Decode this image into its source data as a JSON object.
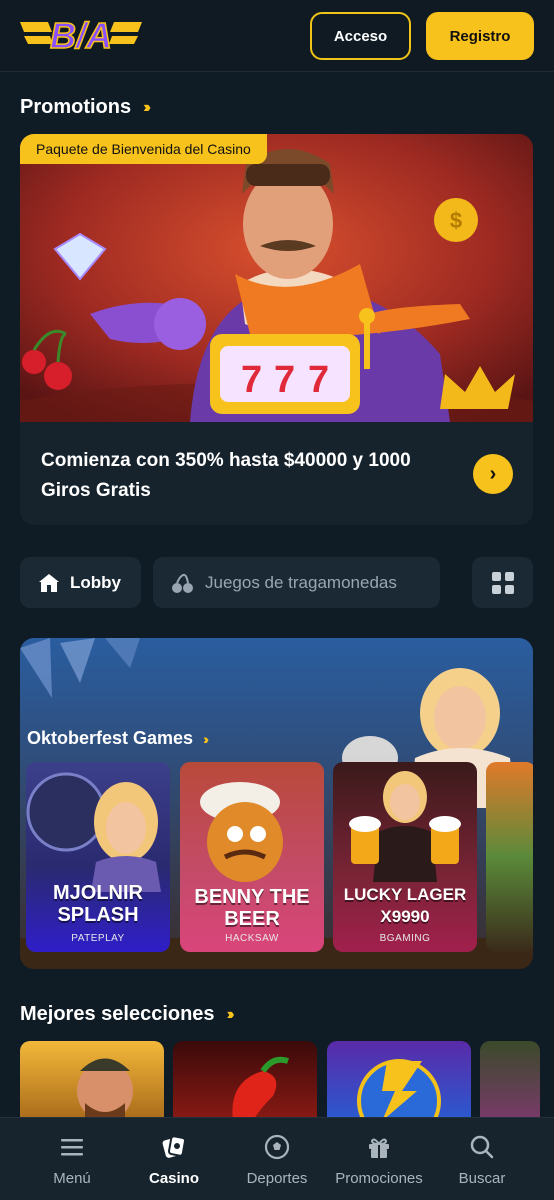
{
  "header": {
    "logo_text": "B/A",
    "login_label": "Acceso",
    "register_label": "Registro"
  },
  "promotions": {
    "title": "Promotions",
    "badge": "Paquete de Bienvenida del Casino",
    "headline": "Comienza con 350% hasta $40000 y 1000 Giros Gratis"
  },
  "tabs": [
    {
      "label": "Lobby",
      "icon": "home-icon",
      "active": true
    },
    {
      "label": "Juegos de tragamonedas",
      "icon": "cherries-icon",
      "active": false
    }
  ],
  "oktoberfest": {
    "title": "Oktoberfest Games",
    "games": [
      {
        "name": "MJOLNIR SPLASH",
        "provider": "PATEPLAY"
      },
      {
        "name": "BENNY THE BEER",
        "provider": "HACKSAW"
      },
      {
        "name": "LUCKY LAGER X9990",
        "provider": "BGAMING"
      }
    ]
  },
  "top_picks": {
    "title": "Mejores selecciones"
  },
  "bottom_nav": [
    {
      "label": "Menú",
      "icon": "menu-icon"
    },
    {
      "label": "Casino",
      "icon": "casino-chip-icon",
      "active": true
    },
    {
      "label": "Deportes",
      "icon": "soccer-ball-icon"
    },
    {
      "label": "Promociones",
      "icon": "gift-icon"
    },
    {
      "label": "Buscar",
      "icon": "search-icon"
    }
  ],
  "colors": {
    "accent": "#f7c21c",
    "background": "#0f1c25",
    "card": "#1b2935"
  }
}
